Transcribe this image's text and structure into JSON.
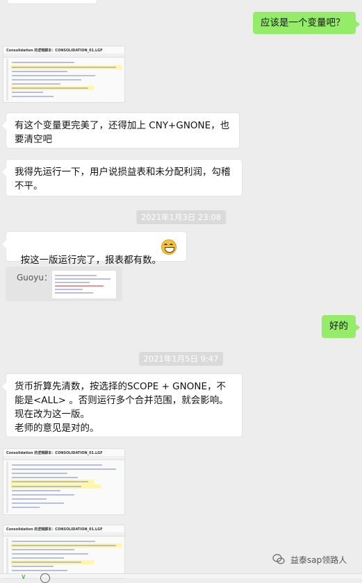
{
  "messages": {
    "m1": "应该是一个变量吧？",
    "m2": "有这个变量更完美了，还得加上 CNY+GNONE，也要清空吧",
    "m3": "我得先运行一下，用户说损益表和未分配利润，勾稽不平。",
    "m4": "按这一版运行完了，报表都有数。",
    "m5": "好的",
    "m6": "货币折算先清数，按选择的SCOPE + GNONE，不能是<ALL> 。否则运行多个合并范围，就会影响。现在改为这一版。\n老师的意见是对的。"
  },
  "timestamps": {
    "t1": "2021年1月3日 23:08",
    "t2": "2021年1月5日 9:47"
  },
  "quote": {
    "sender": "Guoyu："
  },
  "screenshots": {
    "title": "Consolidation 的逻辑脚本：CONSOLIDATION_01.LGF"
  },
  "watermark": "益泰sap领路人",
  "icons": {
    "emoji": "grinning-face-icon",
    "watermark": "wechat-icon"
  }
}
